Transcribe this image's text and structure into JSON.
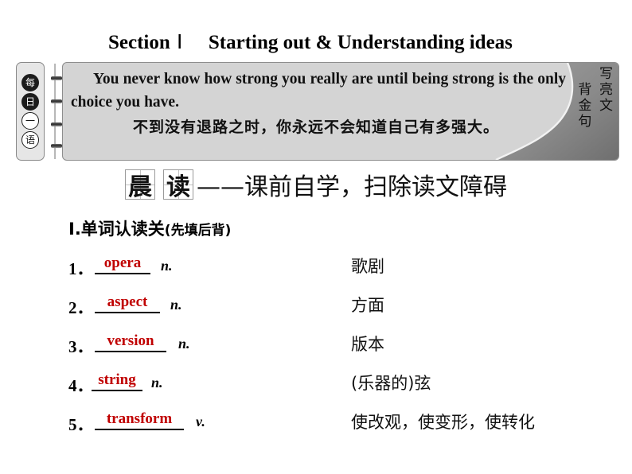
{
  "title": {
    "section_label": "Section",
    "roman": "Ⅰ",
    "subtitle": "Starting out & Understanding ideas"
  },
  "quote_box": {
    "left_tab_glyphs": [
      "每",
      "日",
      "一",
      "语"
    ],
    "english": "You never know how strong you really are until being strong is the only choice you have.",
    "chinese": "不到没有退路之时，你永远不会知道自己有多强大。",
    "right_tab_col1": "写亮文",
    "right_tab_col2": "背金句",
    "panel_color": "#d4d4d4",
    "tab_color": "#8c8c8c"
  },
  "section_header": {
    "char1": "晨",
    "char2": "读",
    "tail": "——课前自学，扫除读文障碍"
  },
  "heading": {
    "numeral": "Ⅰ.",
    "text": "单词认读关",
    "note": "(先填后背)"
  },
  "words": [
    {
      "num": "1．",
      "answer": "opera",
      "pos": "n.",
      "meaning": "歌剧"
    },
    {
      "num": "2．",
      "answer": "aspect",
      "pos": "n.",
      "meaning": "方面"
    },
    {
      "num": "3．",
      "answer": "version",
      "pos": "n.",
      "meaning": "版本"
    },
    {
      "num": "4．",
      "answer": "string",
      "pos": "n.",
      "meaning": "(乐器的)弦"
    },
    {
      "num": "5．",
      "answer": "transform",
      "pos": "v.",
      "meaning": "使改观，使变形，使转化"
    }
  ],
  "colors": {
    "answer_red": "#c00000",
    "ink": "#111111"
  }
}
